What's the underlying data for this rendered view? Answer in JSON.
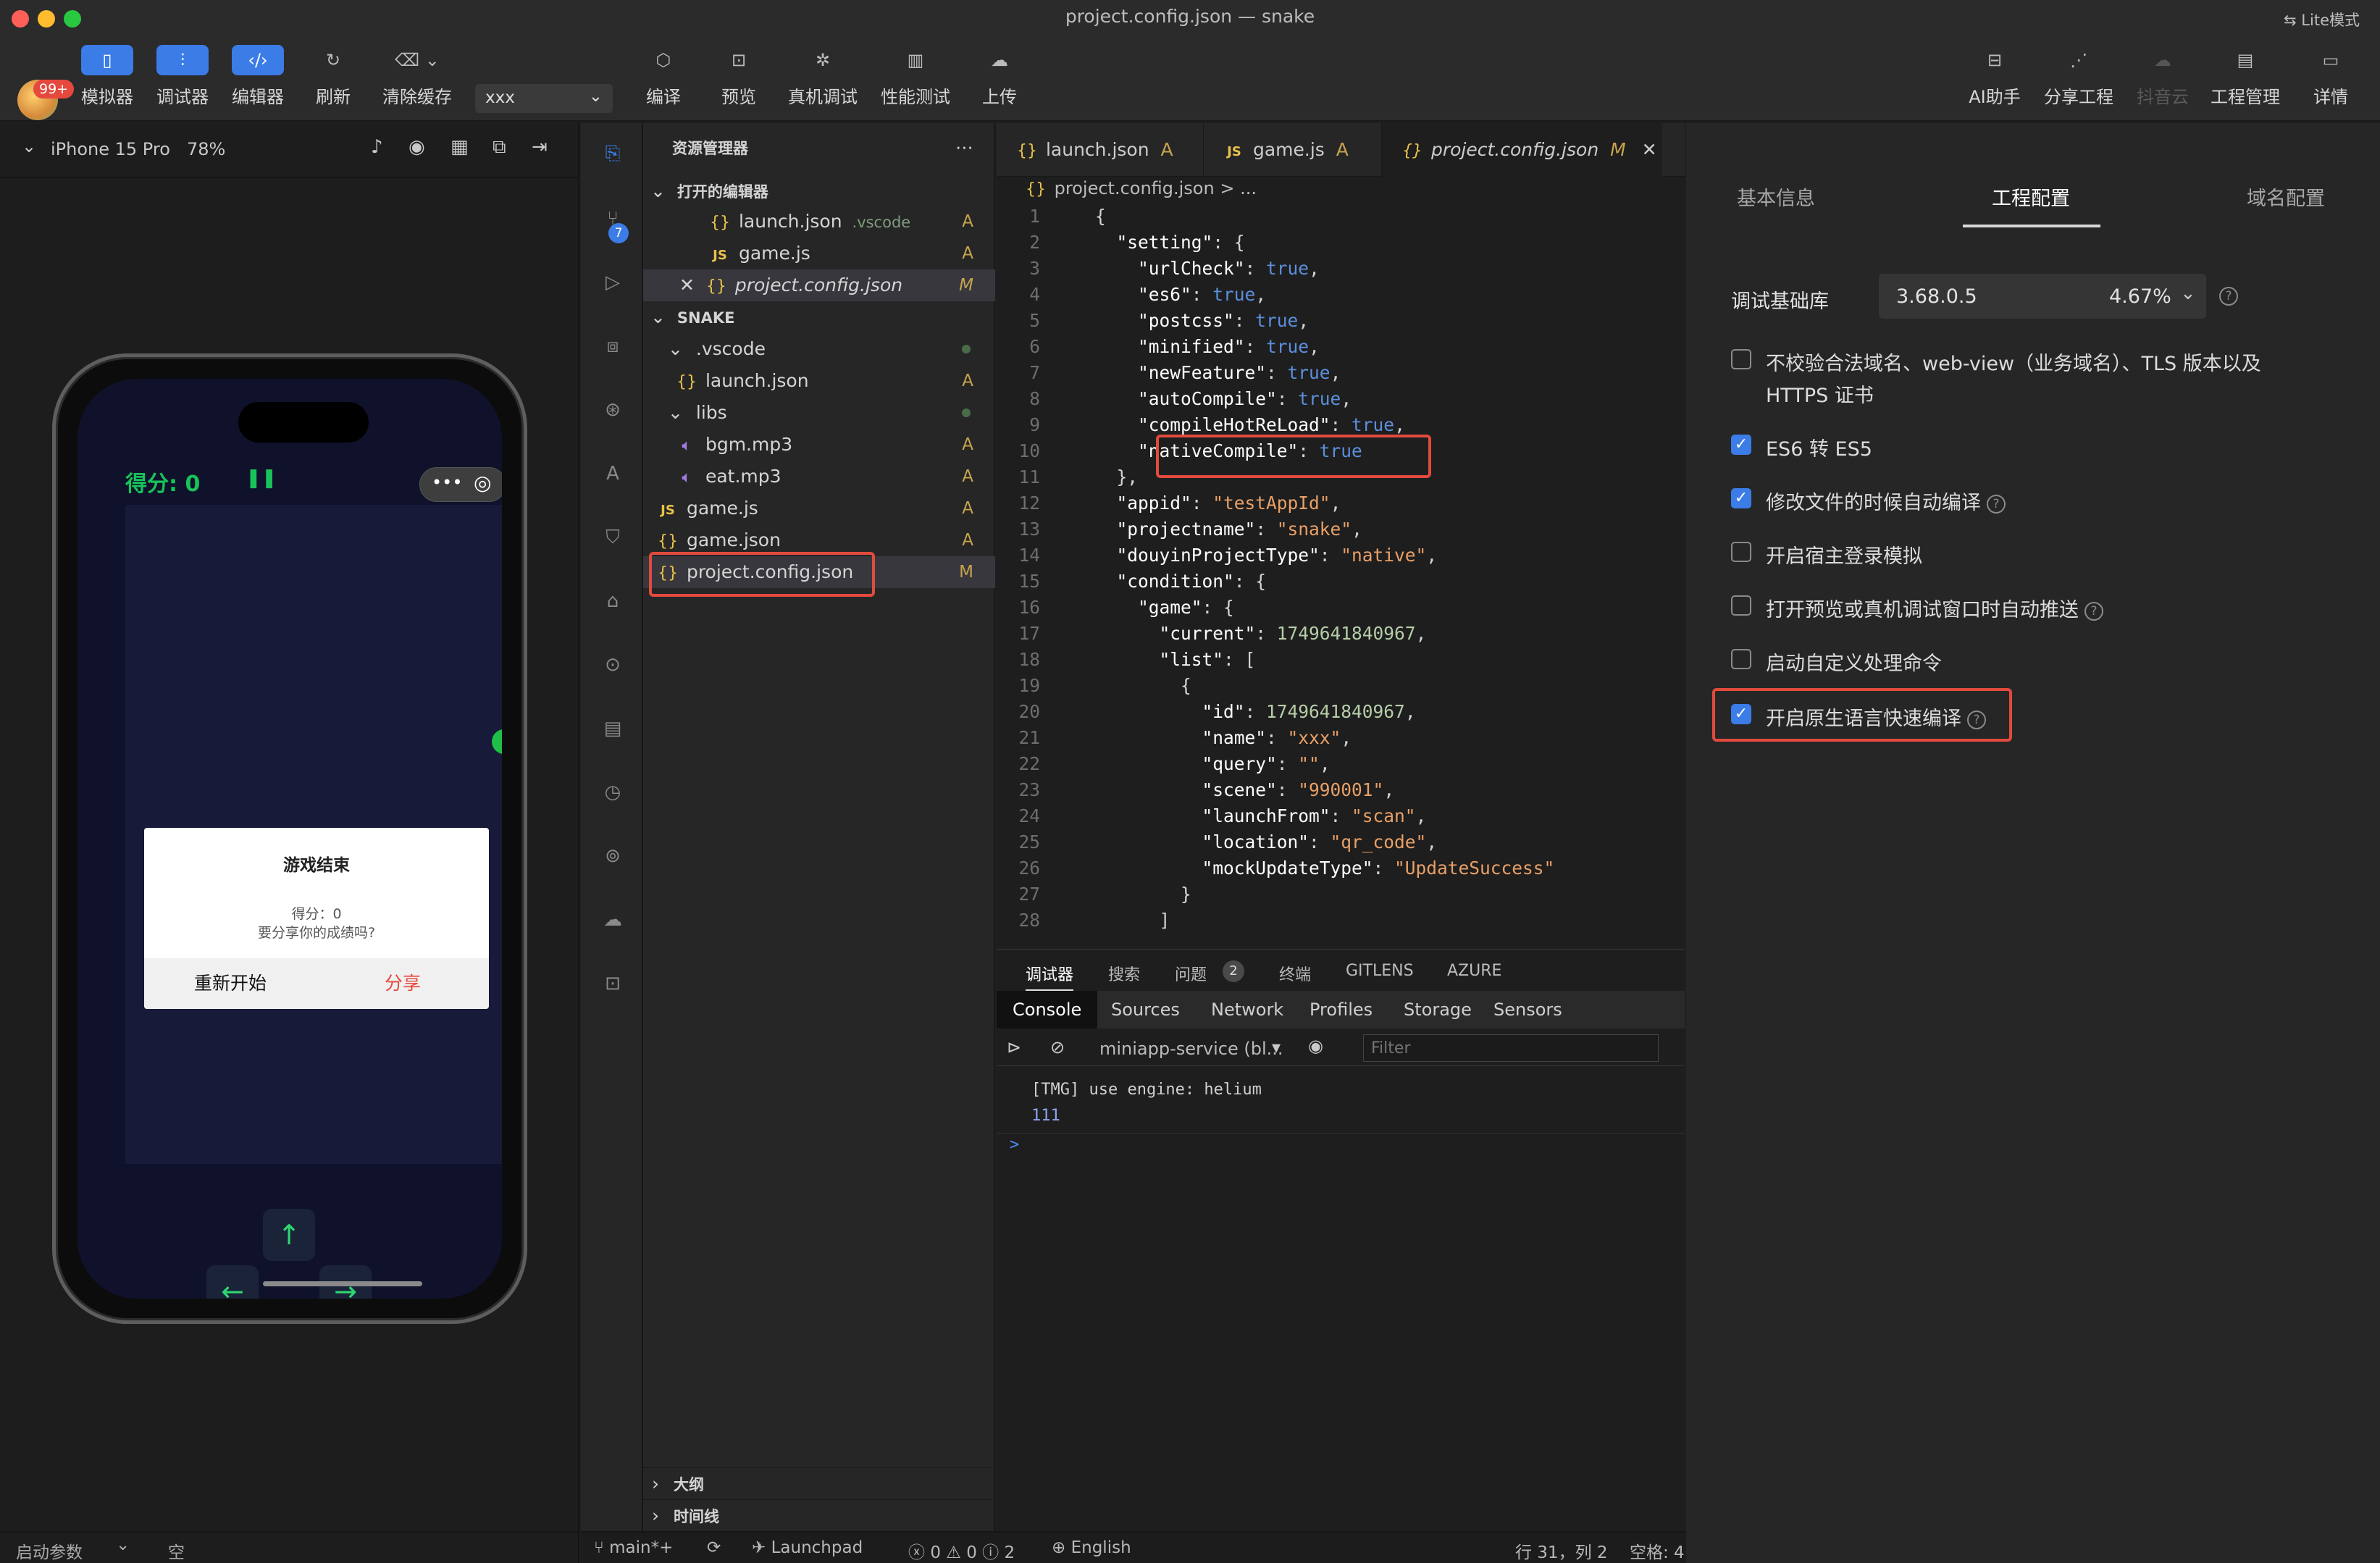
{
  "window": {
    "title": "project.config.json — snake",
    "lite_mode": "Lite模式"
  },
  "toolbar": {
    "badge": "99+",
    "items": [
      {
        "label": "模拟器",
        "icon": "phone-icon"
      },
      {
        "label": "调试器",
        "icon": "sliders-icon"
      },
      {
        "label": "编辑器",
        "icon": "code-icon"
      },
      {
        "label": "刷新",
        "icon": "refresh-icon"
      },
      {
        "label": "清除缓存",
        "icon": "clear-cache-icon"
      }
    ],
    "compile_select": "xxx",
    "actions": [
      {
        "label": "编译",
        "icon": "cube-icon"
      },
      {
        "label": "预览",
        "icon": "preview-icon"
      },
      {
        "label": "真机调试",
        "icon": "bug-icon"
      },
      {
        "label": "性能测试",
        "icon": "chart-icon"
      },
      {
        "label": "上传",
        "icon": "upload-icon"
      }
    ],
    "right": [
      {
        "label": "AI助手",
        "icon": "robot-icon"
      },
      {
        "label": "分享工程",
        "icon": "share-icon"
      },
      {
        "label": "抖音云",
        "icon": "cloud-icon"
      },
      {
        "label": "工程管理",
        "icon": "clipboard-icon"
      },
      {
        "label": "详情",
        "icon": "details-icon"
      }
    ]
  },
  "simulator": {
    "device": "iPhone 15 Pro",
    "zoom": "78%",
    "score": "得分: 0",
    "dialog": {
      "title": "游戏结束",
      "line1": "得分：0",
      "line2": "要分享你的成绩吗?",
      "restart": "重新开始",
      "share": "分享"
    },
    "arrows": {
      "up": "↑",
      "left": "←",
      "right": "→",
      "down": "↓"
    },
    "footer": {
      "launch_params": "启动参数",
      "empty": "空"
    }
  },
  "explorer": {
    "title": "资源管理器",
    "open_editors": "打开的编辑器",
    "open_files": [
      {
        "name": "launch.json",
        "extra": ".vscode",
        "status": "A"
      },
      {
        "name": "game.js",
        "extra": "",
        "status": "A"
      },
      {
        "name": "project.config.json",
        "extra": "",
        "status": "M"
      }
    ],
    "project": "SNAKE",
    "tree": [
      {
        "name": ".vscode",
        "status": ""
      },
      {
        "name": "launch.json",
        "status": "A"
      },
      {
        "name": "libs",
        "status": ""
      },
      {
        "name": "bgm.mp3",
        "status": "A"
      },
      {
        "name": "eat.mp3",
        "status": "A"
      },
      {
        "name": "game.js",
        "status": "A"
      },
      {
        "name": "game.json",
        "status": "A"
      },
      {
        "name": "project.config.json",
        "status": "M"
      }
    ],
    "outline": "大纲",
    "timeline": "时间线",
    "scm_badge": "7"
  },
  "editor": {
    "tabs": [
      {
        "name": "launch.json",
        "status": "A"
      },
      {
        "name": "game.js",
        "status": "A"
      },
      {
        "name": "project.config.json",
        "status": "M"
      }
    ],
    "breadcrumb": "project.config.json > ...",
    "lines": [
      "{",
      "  \"setting\": {",
      "    \"urlCheck\": true,",
      "    \"es6\": true,",
      "    \"postcss\": true,",
      "    \"minified\": true,",
      "    \"newFeature\": true,",
      "    \"autoCompile\": true,",
      "    \"compileHotReLoad\": true,",
      "    \"nativeCompile\": true",
      "  },",
      "  \"appid\": \"testAppId\",",
      "  \"projectname\": \"snake\",",
      "  \"douyinProjectType\": \"native\",",
      "  \"condition\": {",
      "    \"game\": {",
      "      \"current\": 1749641840967,",
      "      \"list\": [",
      "        {",
      "          \"id\": 1749641840967,",
      "          \"name\": \"xxx\",",
      "          \"query\": \"\",",
      "          \"scene\": \"990001\",",
      "          \"launchFrom\": \"scan\",",
      "          \"location\": \"qr_code\",",
      "          \"mockUpdateType\": \"UpdateSuccess\"",
      "        }",
      "      ]"
    ]
  },
  "panel": {
    "tabs": [
      "调试器",
      "搜索",
      "问题",
      "终端",
      "GITLENS",
      "AZURE"
    ],
    "problems_count": "2",
    "devtools_tabs": [
      "Console",
      "Sources",
      "Network",
      "Profiles",
      "Storage",
      "Sensors"
    ],
    "context": "miniapp-service (bl...",
    "filter_placeholder": "Filter",
    "console": [
      "[TMG] use engine:  helium",
      "111"
    ],
    "prompt": ">"
  },
  "statusbar": {
    "branch": "main*+",
    "launchpad": "Launchpad",
    "errors": "0",
    "warnings": "0",
    "info": "2",
    "language": "English",
    "position": "行 31，列 2",
    "spaces": "空格: 4"
  },
  "settings": {
    "tabs": [
      "基本信息",
      "工程配置",
      "域名配置"
    ],
    "base_lib_label": "调试基础库",
    "base_lib_version": "3.68.0.5",
    "base_lib_pct": "4.67%",
    "options": [
      {
        "label": "不校验合法域名、web-view（业务域名）、TLS 版本以及",
        "label2": "HTTPS 证书",
        "checked": false,
        "help": false
      },
      {
        "label": "ES6 转 ES5",
        "checked": true,
        "help": false
      },
      {
        "label": "修改文件的时候自动编译",
        "checked": true,
        "help": true
      },
      {
        "label": "开启宿主登录模拟",
        "checked": false,
        "help": false
      },
      {
        "label": "打开预览或真机调试窗口时自动推送",
        "checked": false,
        "help": true
      },
      {
        "label": "启动自定义处理命令",
        "checked": false,
        "help": false
      },
      {
        "label": "开启原生语言快速编译",
        "checked": true,
        "help": true
      }
    ]
  },
  "colors": {
    "accent": "#3b7ce6",
    "highlight": "#e24a3e",
    "snake_green": "#17c35a"
  }
}
